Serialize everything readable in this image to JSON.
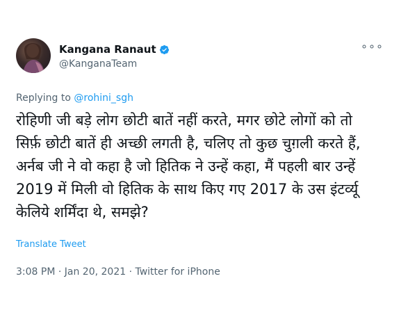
{
  "user": {
    "display_name": "Kangana Ranaut",
    "handle": "@KanganaTeam",
    "verified": true
  },
  "more_icon": "more-horizontal-icon",
  "replying": {
    "prefix": "Replying to ",
    "mention": "@rohini_sgh"
  },
  "tweet": {
    "lines": [
      "रोहिणी जी बड़े लोग छोटी बातें नहीं करते, मगर छोटे लोगों को तो",
      "सिर्फ़ छोटी बातें ही अच्छी लगती है, चलिए तो कुछ चुग़ली करते हैं,",
      "अर्नब जी ने वो कहा है जो हितिक ने उन्हें कहा, मैं पहली बार उन्हें",
      "2019 में मिली वो हितिक के साथ किए गए 2017 के उस इंटर्व्यू",
      "केलिये शर्मिंदा थे, समझे?"
    ]
  },
  "translate_label": "Translate Tweet",
  "meta": "3:08 PM · Jan 20, 2021 · Twitter for iPhone",
  "colors": {
    "link": "#1d9bf0",
    "secondary": "#536471",
    "text": "#0f1419"
  }
}
